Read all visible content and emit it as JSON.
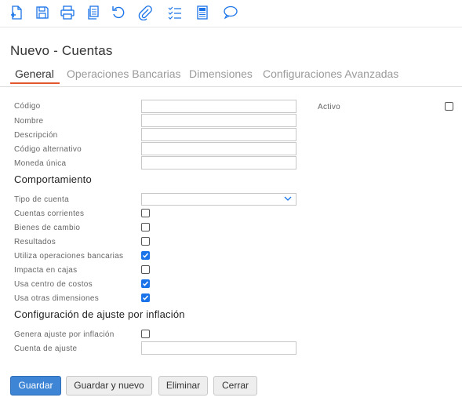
{
  "toolbar": {
    "icons": [
      "new-document-icon",
      "save-icon",
      "print-icon",
      "copy-icon",
      "undo-icon",
      "attach-icon",
      "checklist-icon",
      "report-icon",
      "comment-icon"
    ]
  },
  "page": {
    "title": "Nuevo - Cuentas"
  },
  "tabs": [
    {
      "label": "General",
      "active": true
    },
    {
      "label": "Operaciones Bancarias",
      "active": false
    },
    {
      "label": "Dimensiones",
      "active": false
    },
    {
      "label": "Configuraciones Avanzadas",
      "active": false
    }
  ],
  "fields": {
    "codigo": {
      "label": "Código",
      "value": ""
    },
    "nombre": {
      "label": "Nombre",
      "value": ""
    },
    "descripcion": {
      "label": "Descripción",
      "value": ""
    },
    "codigo_alternativo": {
      "label": "Código alternativo",
      "value": ""
    },
    "moneda_unica": {
      "label": "Moneda única",
      "value": ""
    },
    "activo": {
      "label": "Activo",
      "checked": false
    }
  },
  "comportamiento": {
    "title": "Comportamiento",
    "tipo_cuenta": {
      "label": "Tipo de cuenta",
      "value": ""
    },
    "checks": [
      {
        "label": "Cuentas corrientes",
        "checked": false
      },
      {
        "label": "Bienes de cambio",
        "checked": false
      },
      {
        "label": "Resultados",
        "checked": false
      },
      {
        "label": "Utiliza operaciones bancarias",
        "checked": true
      },
      {
        "label": "Impacta en cajas",
        "checked": false
      },
      {
        "label": "Usa centro de costos",
        "checked": true
      },
      {
        "label": "Usa otras dimensiones",
        "checked": true
      }
    ]
  },
  "inflacion": {
    "title": "Configuración de ajuste por inflación",
    "genera_ajuste": {
      "label": "Genera ajuste por inflación",
      "checked": false
    },
    "cuenta_ajuste": {
      "label": "Cuenta de ajuste",
      "value": ""
    }
  },
  "actions": {
    "guardar": "Guardar",
    "guardar_nuevo": "Guardar y nuevo",
    "eliminar": "Eliminar",
    "cerrar": "Cerrar"
  },
  "colors": {
    "accent": "#1a73e8",
    "tab_underline": "#e4572e",
    "primary_button": "#3e85d5"
  }
}
